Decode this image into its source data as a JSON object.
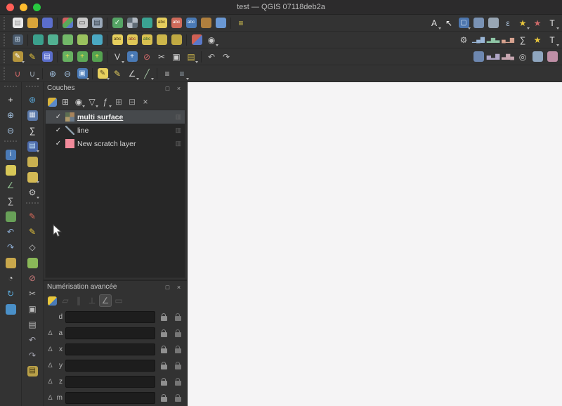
{
  "window": {
    "title": "test — QGIS 07118deb2a",
    "traffic_lights": [
      "#ff5f57",
      "#febc2e",
      "#28c840"
    ]
  },
  "toolbars": {
    "row1": [
      {
        "h": true
      },
      {
        "n": "new-project-icon",
        "t": "#e9e9e9",
        "g": "▤",
        "f": "#9a9a9a"
      },
      {
        "n": "open-project-icon",
        "t": "#d9a53a"
      },
      {
        "n": "save-project-icon",
        "t": "#5b6ecb"
      },
      {
        "sep": true
      },
      {
        "n": "style-manager-icon",
        "t": "linear-gradient(135deg,#d06060 0 33%,#5aa85a 33% 66%,#5a78c8 66%)"
      },
      {
        "n": "new-print-layout-icon",
        "t": "#c9c9c9",
        "g": "▭",
        "f": "#555555"
      },
      {
        "n": "layout-manager-icon",
        "t": "#9aa8b8",
        "g": "▤",
        "f": "#2e3a46"
      },
      {
        "sep": true
      },
      {
        "n": "add-vector-layer-icon",
        "t": "#55a465",
        "g": "✓",
        "f": "#eaffea"
      },
      {
        "n": "add-raster-layer-icon",
        "t": "conic-gradient(#b2bac2 0 25%,#5f6b75 0 50%,#b2bac2 0 75%,#5f6b75 0)"
      },
      {
        "n": "add-mesh-layer-icon",
        "t": "#3aa392"
      },
      {
        "n": "add-delimited-text-icon",
        "t": "#e5cd5d",
        "g": "abc",
        "f": "#4a3b12"
      },
      {
        "n": "add-spatialite-icon",
        "t": "#cf6a5a",
        "g": "abc",
        "f": "#ffffff"
      },
      {
        "n": "add-postgis-icon",
        "t": "#4a7ab6",
        "g": "abc",
        "f": "#e7f0fa"
      },
      {
        "n": "add-wms-icon",
        "t": "#b07f3e"
      },
      {
        "n": "add-wfs-icon",
        "t": "#6a98d4"
      },
      {
        "sep": true
      },
      {
        "n": "python-console-icon",
        "g": "≡",
        "f": "#e3cf52"
      },
      {
        "right": true,
        "n": "annotation-style-icon",
        "g": "A",
        "f": "#e6e6e6",
        "dd": true
      },
      {
        "n": "select-tool-icon",
        "g": "↖",
        "f": "#f2f2f2"
      },
      {
        "n": "select-features-icon",
        "t": "#4d76ae",
        "g": "▢",
        "f": "#d7e6f6",
        "dd": true
      },
      {
        "n": "select-by-value-icon",
        "t": "#7a93b5"
      },
      {
        "n": "deselect-all-icon",
        "t": "#98a6b4"
      },
      {
        "n": "select-by-expression-icon",
        "g": "ε",
        "f": "#a9c0d8"
      },
      {
        "n": "new-spatial-bookmark-icon",
        "g": "★",
        "f": "#e9c73c",
        "dd": true
      },
      {
        "n": "show-bookmarks-icon",
        "g": "★",
        "f": "#cf6a6a"
      },
      {
        "n": "text-annotation-icon",
        "g": "T",
        "f": "#f0f0f0",
        "dd": true
      }
    ],
    "row2": [
      {
        "h": true
      },
      {
        "n": "data-source-manager-icon",
        "t": "#49596b",
        "g": "⊞",
        "f": "#cfe0f0"
      },
      {
        "sep": true
      },
      {
        "n": "new-geopackage-layer-icon",
        "t": "#3ba08c"
      },
      {
        "n": "new-shapefile-layer-icon",
        "t": "#52b192"
      },
      {
        "n": "new-spatialite-layer-icon",
        "t": "#72b868"
      },
      {
        "n": "new-virtual-layer-icon",
        "t": "#9ac25e"
      },
      {
        "n": "new-scratch-layer-icon",
        "t": "#4aa8c2"
      },
      {
        "sep": true
      },
      {
        "n": "layer-labeling-icon",
        "t": "#e6cf5e",
        "g": "abc",
        "f": "#4a3b12"
      },
      {
        "n": "layer-diagram-icon",
        "t": "#dfc757",
        "g": "abc",
        "f": "#8a2f2f"
      },
      {
        "n": "pin-labels-icon",
        "t": "#d8c050",
        "g": "abc",
        "f": "#2f6a2f"
      },
      {
        "n": "highlight-pinned-labels-icon",
        "t": "#cdb64a"
      },
      {
        "n": "move-label-icon",
        "t": "#c0a942"
      },
      {
        "sep": true
      },
      {
        "n": "show-unplaced-labels-icon",
        "t": "linear-gradient(135deg,#cf6054 0 50%,#5a78c8 0)"
      },
      {
        "n": "map-theme-icon",
        "g": "◉",
        "f": "#c9c9c9",
        "dd": true
      },
      {
        "right": true,
        "n": "processing-toolbox-icon",
        "g": "⚙",
        "f": "#cccccc"
      },
      {
        "n": "plot-histogram-icon",
        "g": "▁▄▇",
        "f": "#9ab6d6"
      },
      {
        "n": "plot-bars-icon",
        "g": "▂▆▃",
        "f": "#8fc6a6"
      },
      {
        "n": "plot-scatter-icon",
        "g": "▄▁▆",
        "f": "#d6a28f"
      },
      {
        "n": "statistics-sum-icon",
        "g": "∑",
        "f": "#dddddd"
      },
      {
        "n": "star-favorites-icon",
        "g": "★",
        "f": "#e9c73c"
      },
      {
        "n": "help-text-icon",
        "g": "T",
        "f": "#eeeeee",
        "dd": true
      }
    ],
    "row3": [
      {
        "h": true
      },
      {
        "n": "current-edits-icon",
        "t": "#b5953c",
        "g": "✎",
        "f": "#ffffff",
        "dd": true
      },
      {
        "n": "toggle-editing-icon",
        "g": "✎",
        "f": "#e9c73c"
      },
      {
        "n": "save-layer-edits-icon",
        "t": "#5b6ecb",
        "g": "▤",
        "f": "#dfe6ff"
      },
      {
        "sep": true
      },
      {
        "n": "add-point-feature-icon",
        "t": "#67b161",
        "g": "+",
        "f": "#ffe34a"
      },
      {
        "n": "add-line-feature-icon",
        "t": "#5daa58",
        "g": "+",
        "f": "#ffe34a"
      },
      {
        "n": "add-polygon-feature-icon",
        "t": "#54a250",
        "g": "+",
        "f": "#ffe34a"
      },
      {
        "sep": true
      },
      {
        "n": "vertex-tool-icon",
        "g": "V",
        "f": "#d6d6d6",
        "dd": true
      },
      {
        "n": "move-feature-icon",
        "t": "#4a7ab6",
        "g": "+",
        "f": "#ffffff"
      },
      {
        "n": "delete-selected-icon",
        "g": "⊘",
        "f": "#d06868"
      },
      {
        "n": "cut-features-icon",
        "g": "✂",
        "f": "#cccccc"
      },
      {
        "n": "copy-features-icon",
        "g": "▣",
        "f": "#cccccc"
      },
      {
        "n": "paste-features-icon",
        "g": "▤",
        "f": "#cdb64a",
        "dd": true
      },
      {
        "sep": true
      },
      {
        "n": "undo-icon",
        "g": "↶",
        "f": "#bbbbbb"
      },
      {
        "n": "redo-icon",
        "g": "↷",
        "f": "#bbbbbb"
      },
      {
        "right": true,
        "n": "raster-stretch-icon",
        "t": "#6d87b0"
      },
      {
        "n": "raster-histogram-icon",
        "g": "▅▂▇",
        "f": "#b0a6c6"
      },
      {
        "n": "local-histogram-icon",
        "g": "▃▇▄",
        "f": "#c6a6b0"
      },
      {
        "n": "zoom-actual-size-icon",
        "g": "◎",
        "f": "#cccccc"
      },
      {
        "n": "raster-contrast-icon",
        "t": "#8fa6bf"
      },
      {
        "n": "flip-color-icon",
        "t": "#bf8fa6"
      }
    ],
    "row4": [
      {
        "h": true
      },
      {
        "n": "snapping-toggle-icon",
        "g": "∪",
        "f": "#d86a6a"
      },
      {
        "n": "snapping-options-icon",
        "g": "∪",
        "f": "#9aa6b2",
        "dd": true
      },
      {
        "sep": true
      },
      {
        "n": "zoom-in-tool-icon",
        "g": "⊕",
        "f": "#a6c6e6"
      },
      {
        "n": "zoom-out-tool-icon",
        "g": "⊖",
        "f": "#a6c6e6"
      },
      {
        "n": "zoom-full-extent-icon",
        "t": "#4a7ab6",
        "g": "▣",
        "f": "#d7e6f6",
        "dd": true
      },
      {
        "sep": true
      },
      {
        "n": "new-map-annotation-icon",
        "t": "#e6cf5e",
        "g": "✎",
        "f": "#5a4a20",
        "dd": true
      },
      {
        "n": "highlight-pen-icon",
        "g": "✎",
        "f": "#e6cf5e"
      },
      {
        "n": "measure-angle-icon",
        "g": "∠",
        "f": "#cccccc",
        "dd": true
      },
      {
        "n": "measure-line-icon",
        "g": "╱",
        "f": "#a6c6a6",
        "dd": true
      },
      {
        "sep": true
      },
      {
        "n": "map-tips-toggle-icon",
        "g": "≡",
        "f": "#cccccc"
      },
      {
        "n": "decorations-icon",
        "g": "≡",
        "f": "#9aa6b2",
        "dd": true
      }
    ],
    "left_outer": [
      {
        "hh": true
      },
      {
        "n": "pan-map-icon",
        "g": "+",
        "f": "#f0f0f0"
      },
      {
        "n": "zoom-in-map-icon",
        "g": "⊕",
        "f": "#a6c6e6"
      },
      {
        "n": "zoom-out-map-icon",
        "g": "⊖",
        "f": "#a6c6e6"
      },
      {
        "hh": true
      },
      {
        "n": "identify-features-icon",
        "t": "#4a7ab6",
        "g": "i",
        "f": "#ffffff"
      },
      {
        "n": "select-rect-icon",
        "t": "#d8c858"
      },
      {
        "n": "measure-distance-icon",
        "g": "∠",
        "f": "#8fbf8f"
      },
      {
        "n": "statistical-summary-icon",
        "g": "∑",
        "f": "#cccccc"
      },
      {
        "n": "zoom-to-layer-icon",
        "t": "#68a058"
      },
      {
        "n": "zoom-last-icon",
        "g": "↶",
        "f": "#8fb0d8"
      },
      {
        "n": "zoom-next-icon",
        "g": "↷",
        "f": "#8fb0d8"
      },
      {
        "n": "form-annotation-icon",
        "t": "#c9a84c"
      },
      {
        "n": "temporal-controller-icon",
        "g": "◔",
        "f": "#d8d8d8"
      },
      {
        "n": "refresh-map-icon",
        "g": "↻",
        "f": "#5aa8d8"
      },
      {
        "n": "map-overview-icon",
        "t": "#4a90c8"
      }
    ],
    "left_inner": [
      {
        "hh": true
      },
      {
        "n": "zoom-to-native-icon",
        "g": "⊕",
        "f": "#5aa8d8"
      },
      {
        "n": "attributes-table-icon",
        "t": "#5a78a8",
        "g": "▦",
        "f": "#dfe6f0"
      },
      {
        "n": "field-statistics-icon",
        "g": "∑",
        "f": "#e6e6e6"
      },
      {
        "n": "open-data-table-icon",
        "t": "#4a68a8",
        "g": "▤",
        "f": "#cfeeff",
        "dd": true
      },
      {
        "n": "map-tip-bubble-icon",
        "t": "#c9b050"
      },
      {
        "n": "callout-icon",
        "t": "#d4ba55",
        "dd": true
      },
      {
        "n": "options-gear-icon",
        "g": "⚙",
        "f": "#c9c9c9",
        "dd": true
      },
      {
        "hh": true
      },
      {
        "n": "toggle-editing-side-icon",
        "g": "✎",
        "f": "#d86a5a"
      },
      {
        "n": "add-feature-side-icon",
        "g": "✎",
        "f": "#e9c73c"
      },
      {
        "n": "vertex-editor-icon",
        "g": "◇",
        "f": "#c9c9c9"
      },
      {
        "n": "multi-edit-icon",
        "t": "#8ab858"
      },
      {
        "n": "delete-feature-icon",
        "g": "⊘",
        "f": "#c87878"
      },
      {
        "n": "cut-side-icon",
        "g": "✂",
        "f": "#b9b9b9"
      },
      {
        "n": "copy-side-icon",
        "g": "▣",
        "f": "#b9b9b9"
      },
      {
        "n": "paste-side-icon",
        "g": "▤",
        "f": "#b9b9b9"
      },
      {
        "n": "undo-side-icon",
        "g": "↶",
        "f": "#a6a6b2"
      },
      {
        "n": "redo-side-icon",
        "g": "↷",
        "f": "#a6a6b2"
      },
      {
        "n": "clipboard-icon",
        "t": "#b9a048",
        "g": "▤",
        "f": "#3a2f10"
      }
    ]
  },
  "panels": {
    "layers": {
      "title": "Couches",
      "float_icon": "□",
      "close_icon": "×",
      "check_glyph": "✓",
      "indicator_glyph": "▥",
      "toolbar": [
        {
          "n": "open-layer-styling-icon",
          "t": "linear-gradient(135deg,#d8b43c 0 50%,#5a88c8 0)"
        },
        {
          "n": "add-group-icon",
          "g": "⊞",
          "f": "#c9c9c9"
        },
        {
          "n": "manage-map-themes-icon",
          "g": "◉",
          "f": "#c9c9c9",
          "dd": true
        },
        {
          "n": "filter-legend-icon",
          "g": "▽",
          "f": "#c9c9c9",
          "dd": true
        },
        {
          "n": "filter-by-expression-icon",
          "g": "ƒ",
          "f": "#c9c9c9",
          "dd": true
        },
        {
          "n": "expand-all-icon",
          "g": "⊞",
          "f": "#9a9a9a"
        },
        {
          "n": "collapse-all-icon",
          "g": "⊟",
          "f": "#9a9a9a"
        },
        {
          "n": "remove-layer-icon",
          "g": "×",
          "f": "#b9b9b9"
        }
      ],
      "items": [
        {
          "label": "multi surface",
          "checked": true,
          "selected": true,
          "type": "raster"
        },
        {
          "label": "line",
          "checked": true,
          "selected": false,
          "type": "line"
        },
        {
          "label": "New scratch layer",
          "checked": true,
          "selected": false,
          "type": "fill",
          "color": "#f28b9b"
        }
      ]
    },
    "cad": {
      "title": "Numérisation avancée",
      "float_icon": "□",
      "close_icon": "×",
      "delta_glyph": "∆",
      "toolbar": [
        {
          "n": "enable-cad-icon",
          "t": "linear-gradient(135deg,#e9c73c 0 55%,#4a7ab6 0)"
        },
        {
          "n": "construction-mode-icon",
          "g": "▱",
          "f": "#8a8a8a",
          "dis": true
        },
        {
          "n": "parallel-icon",
          "g": "∥",
          "f": "#8a8a8a",
          "dis": true
        },
        {
          "n": "perpendicular-icon",
          "g": "⊥",
          "f": "#8a8a8a",
          "dis": true
        },
        {
          "n": "common-angle-snap-icon",
          "g": "∠",
          "f": "#9a9a9a",
          "pr": true
        },
        {
          "n": "floater-icon",
          "g": "▭",
          "f": "#8a8a8a",
          "dis": true
        }
      ],
      "rows": [
        {
          "delta": false,
          "label": "d",
          "value": ""
        },
        {
          "delta": true,
          "label": "a",
          "value": ""
        },
        {
          "delta": true,
          "label": "x",
          "value": ""
        },
        {
          "delta": true,
          "label": "y",
          "value": ""
        },
        {
          "delta": true,
          "label": "z",
          "value": ""
        },
        {
          "delta": true,
          "label": "m",
          "value": ""
        }
      ]
    }
  }
}
